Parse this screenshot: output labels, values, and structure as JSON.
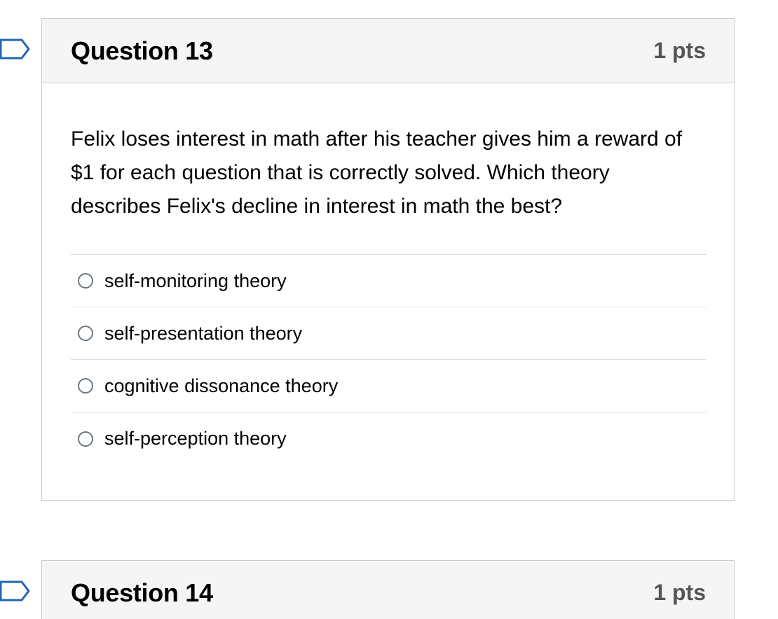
{
  "questions": [
    {
      "title": "Question 13",
      "points": "1 pts",
      "text": "Felix loses interest in math after his teacher gives him a reward of $1 for each question that is correctly solved. Which theory describes Felix's decline in interest in math the best?",
      "answers": [
        "self-monitoring theory",
        "self-presentation theory",
        "cognitive dissonance theory",
        "self-perception theory"
      ]
    },
    {
      "title": "Question 14",
      "points": "1 pts"
    }
  ],
  "icons": {
    "flag": "flag-icon",
    "radio": "radio-button"
  },
  "colors": {
    "header_bg": "#f5f5f5",
    "border": "#c7cdd1",
    "flag_outline": "#1f65b3",
    "points": "#555555"
  }
}
